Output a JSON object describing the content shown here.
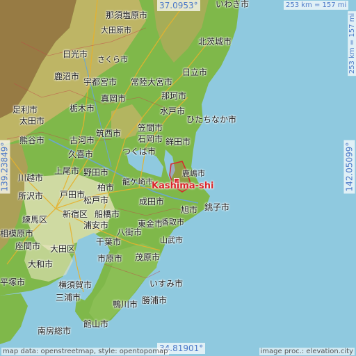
{
  "map": {
    "colors": {
      "sea": "#8fc9df",
      "lowland": "#7fb84a",
      "hills": "#c9b46a",
      "mountains": "#9a7444",
      "urban": "#e9e5c0",
      "highlight": "#d9262b",
      "coord_text": "#4a78c8"
    },
    "coords": {
      "top": "37.0953°",
      "bottom": "34.81901°",
      "left": "139.23849°",
      "right": "142.05099°"
    },
    "scale": {
      "horizontal": "253 km = 157 mi",
      "vertical": "253 km = 157 mi"
    },
    "highlight": {
      "name": "Kashima-shi",
      "jp": "鹿嶋市"
    },
    "attribution": {
      "left": "map data: openstreetmap, style: opentopomap",
      "right": "image proc.: elevation.city"
    },
    "places": [
      {
        "name": "那須塩原市"
      },
      {
        "name": "大田原市"
      },
      {
        "name": "いわき市"
      },
      {
        "name": "北茨城市"
      },
      {
        "name": "日光市"
      },
      {
        "name": "さくら市"
      },
      {
        "name": "日立市"
      },
      {
        "name": "鹿沼市"
      },
      {
        "name": "宇都宮市"
      },
      {
        "name": "常陸大宮市"
      },
      {
        "name": "那珂市"
      },
      {
        "name": "真岡市"
      },
      {
        "name": "水戸市"
      },
      {
        "name": "足利市"
      },
      {
        "name": "栃木市"
      },
      {
        "name": "太田市"
      },
      {
        "name": "ひたちなか市"
      },
      {
        "name": "筑西市"
      },
      {
        "name": "笠間市"
      },
      {
        "name": "石岡市"
      },
      {
        "name": "熊谷市"
      },
      {
        "name": "古河市"
      },
      {
        "name": "鉾田市"
      },
      {
        "name": "久喜市"
      },
      {
        "name": "つくば市"
      },
      {
        "name": "上尾市"
      },
      {
        "name": "野田市"
      },
      {
        "name": "川越市"
      },
      {
        "name": "龍ケ崎市"
      },
      {
        "name": "柏市"
      },
      {
        "name": "所沢市"
      },
      {
        "name": "戸田市"
      },
      {
        "name": "松戸市"
      },
      {
        "name": "成田市"
      },
      {
        "name": "旭市"
      },
      {
        "name": "銚子市"
      },
      {
        "name": "練馬区"
      },
      {
        "name": "新宿区"
      },
      {
        "name": "船橋市"
      },
      {
        "name": "香取市"
      },
      {
        "name": "浦安市"
      },
      {
        "name": "東金市"
      },
      {
        "name": "相模原市"
      },
      {
        "name": "座間市"
      },
      {
        "name": "大田区"
      },
      {
        "name": "千葉市"
      },
      {
        "name": "八街市"
      },
      {
        "name": "山武市"
      },
      {
        "name": "大和市"
      },
      {
        "name": "市原市"
      },
      {
        "name": "茂原市"
      },
      {
        "name": "平塚市"
      },
      {
        "name": "横須賀市"
      },
      {
        "name": "いすみ市"
      },
      {
        "name": "三浦市"
      },
      {
        "name": "勝浦市"
      },
      {
        "name": "鴨川市"
      },
      {
        "name": "館山市"
      },
      {
        "name": "南房総市"
      }
    ]
  }
}
